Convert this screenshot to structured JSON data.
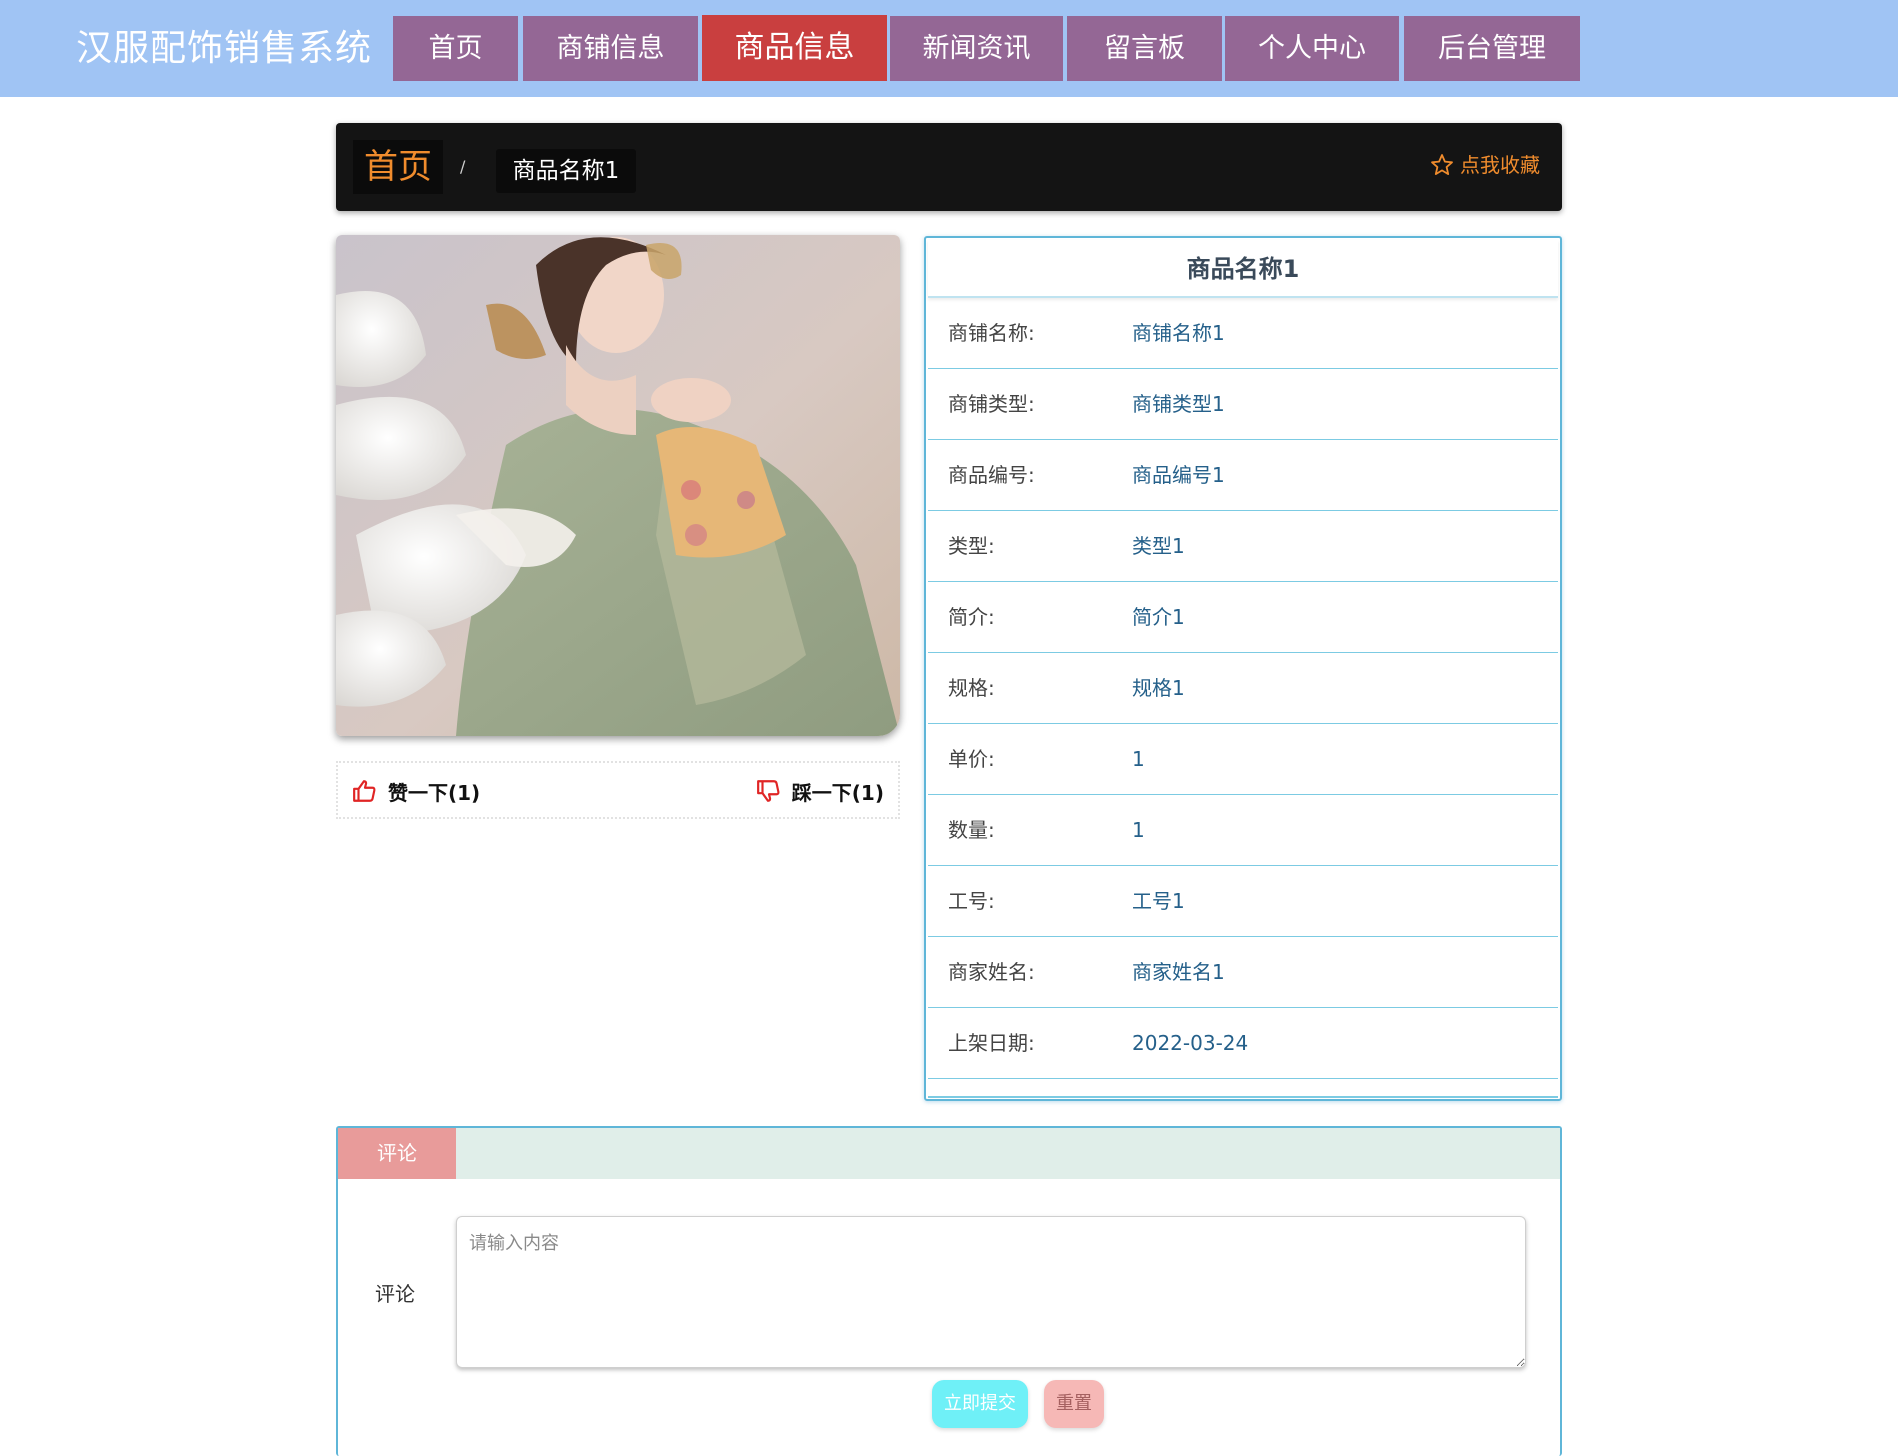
{
  "site": {
    "title": "汉服配饰销售系统"
  },
  "nav": {
    "items": [
      {
        "label": "首页"
      },
      {
        "label": "商铺信息"
      },
      {
        "label": "商品信息",
        "active": true
      },
      {
        "label": "新闻资讯"
      },
      {
        "label": "留言板"
      },
      {
        "label": "个人中心"
      },
      {
        "label": "后台管理"
      }
    ]
  },
  "breadcrumb": {
    "home": "首页",
    "separator": "/",
    "current": "商品名称1",
    "collect_label": "点我收藏",
    "collect_icon": "star-icon"
  },
  "votes": {
    "up_label": "赞一下(1)",
    "down_label": "踩一下(1)"
  },
  "detail": {
    "title": "商品名称1",
    "rows": [
      {
        "key": "商铺名称:",
        "value": "商铺名称1"
      },
      {
        "key": "商铺类型:",
        "value": "商铺类型1"
      },
      {
        "key": "商品编号:",
        "value": "商品编号1"
      },
      {
        "key": "类型:",
        "value": "类型1"
      },
      {
        "key": "简介:",
        "value": "简介1"
      },
      {
        "key": "规格:",
        "value": "规格1"
      },
      {
        "key": "单价:",
        "value": "1"
      },
      {
        "key": "数量:",
        "value": "1"
      },
      {
        "key": "工号:",
        "value": "工号1"
      },
      {
        "key": "商家姓名:",
        "value": "商家姓名1"
      },
      {
        "key": "上架日期:",
        "value": "2022-03-24"
      }
    ]
  },
  "comments": {
    "tab_label": "评论",
    "field_label": "评论",
    "placeholder": "请输入内容",
    "value": "",
    "submit_label": "立即提交",
    "reset_label": "重置"
  },
  "colors": {
    "topbar": "#a0c4f4",
    "nav_item": "#946795",
    "nav_active": "#c93f3f",
    "accent_orange": "#f08c2d",
    "table_border": "#5fb6d8",
    "tab_pink": "#e89b9a",
    "submit_cyan": "#6ff0f7"
  }
}
